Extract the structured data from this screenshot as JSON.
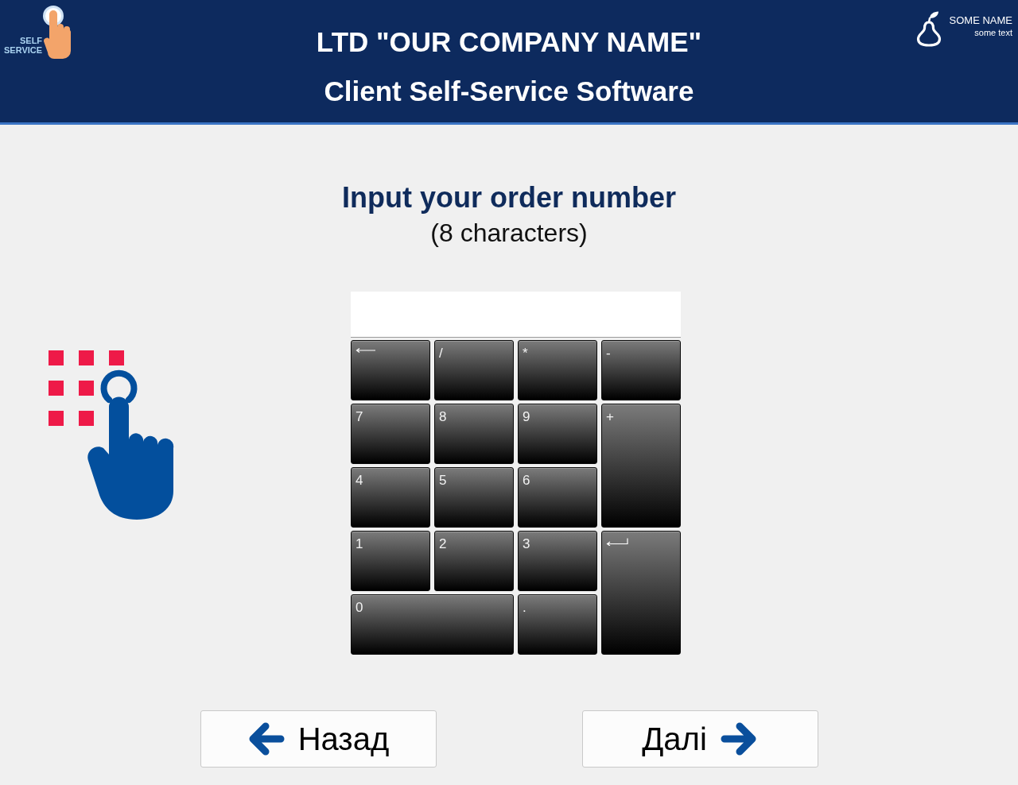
{
  "header": {
    "logo": {
      "lines": [
        "SELF",
        "SERVICE"
      ]
    },
    "title": "LTD \"OUR COMPANY NAME\"",
    "subtitle": "Client Self-Service Software",
    "user": {
      "name": "SOME NAME",
      "detail": "some text"
    }
  },
  "prompt": {
    "title": "Input your order number",
    "hint": "(8 characters)"
  },
  "keypad": {
    "keys": [
      {
        "kind": "backspace"
      },
      {
        "kind": "key",
        "label": "/"
      },
      {
        "kind": "key",
        "label": "*"
      },
      {
        "kind": "key",
        "label": "-"
      },
      {
        "kind": "key",
        "label": "7"
      },
      {
        "kind": "key",
        "label": "8"
      },
      {
        "kind": "key",
        "label": "9"
      },
      {
        "kind": "tall",
        "label": "+"
      },
      {
        "kind": "key",
        "label": "4"
      },
      {
        "kind": "key",
        "label": "5"
      },
      {
        "kind": "key",
        "label": "6"
      },
      {
        "kind": "key",
        "label": "1"
      },
      {
        "kind": "key",
        "label": "2"
      },
      {
        "kind": "key",
        "label": "3"
      },
      {
        "kind": "enter"
      },
      {
        "kind": "wide",
        "label": "0"
      },
      {
        "kind": "key",
        "label": "."
      }
    ]
  },
  "buttons": [
    {
      "kind": "back",
      "label": "Назад"
    },
    {
      "kind": "next",
      "label": "Далі"
    }
  ]
}
